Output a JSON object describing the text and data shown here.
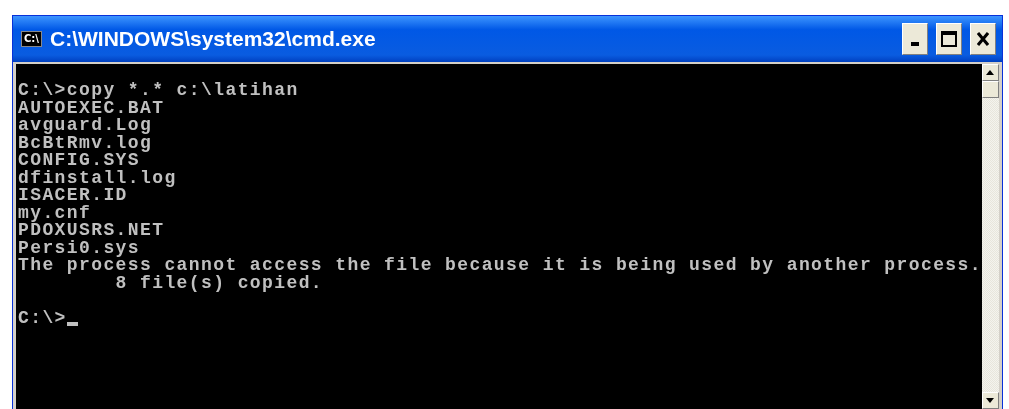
{
  "window": {
    "icon_text": "C:\\",
    "title": "C:\\WINDOWS\\system32\\cmd.exe"
  },
  "console": {
    "lines": [
      "C:\\>copy *.* c:\\latihan",
      "AUTOEXEC.BAT",
      "avguard.Log",
      "BcBtRmv.log",
      "CONFIG.SYS",
      "dfinstall.log",
      "ISACER.ID",
      "my.cnf",
      "PDOXUSRS.NET",
      "Persi0.sys",
      "The process cannot access the file because it is being used by another process.",
      "        8 file(s) copied."
    ],
    "prompt": "C:\\>",
    "cursor": true
  }
}
